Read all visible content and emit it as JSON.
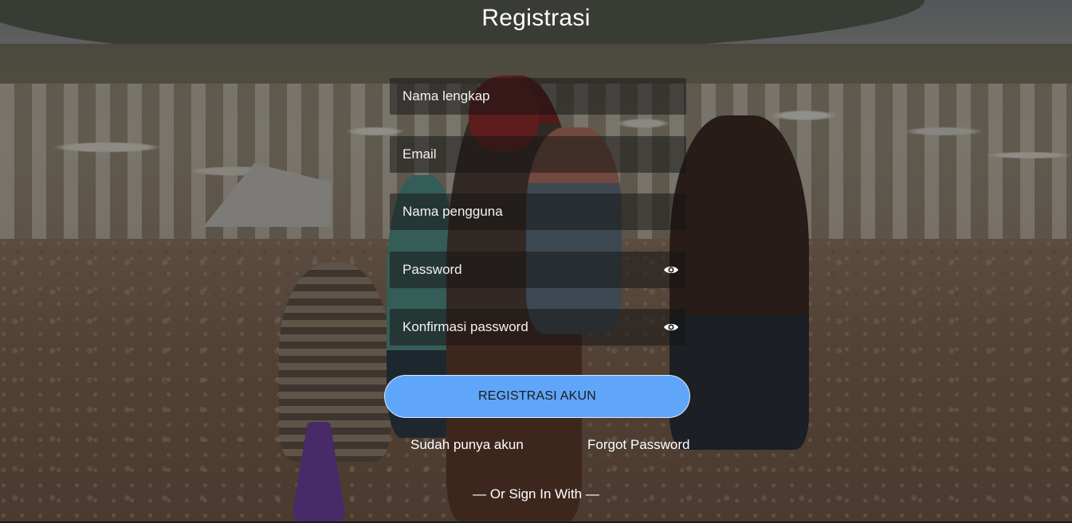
{
  "page": {
    "title": "Registrasi"
  },
  "form": {
    "fields": [
      {
        "name": "fullname",
        "placeholder": "Nama lengkap",
        "type": "text"
      },
      {
        "name": "email",
        "placeholder": "Email",
        "type": "email"
      },
      {
        "name": "username",
        "placeholder": "Nama pengguna",
        "type": "text"
      },
      {
        "name": "password",
        "placeholder": "Password",
        "type": "password",
        "toggle_icon": "eye-icon"
      },
      {
        "name": "confirm_password",
        "placeholder": "Konfirmasi password",
        "type": "password",
        "toggle_icon": "eye-icon"
      }
    ],
    "submit_label": "REGISTRASI AKUN"
  },
  "links": {
    "login": "Sudah punya akun",
    "forgot": "Forgot Password"
  },
  "social": {
    "divider": "— Or Sign In With —"
  },
  "colors": {
    "accent": "#5fa6fb",
    "text": "#ffffff",
    "field_bg": "rgba(22,22,22,0.52)"
  }
}
